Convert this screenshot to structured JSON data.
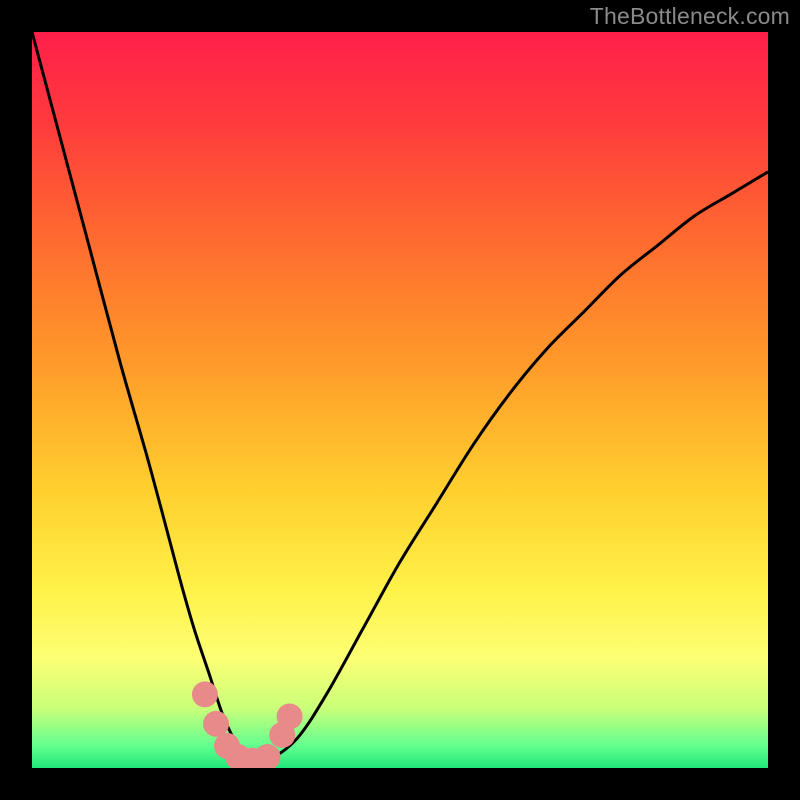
{
  "watermark": "TheBottleneck.com",
  "colors": {
    "black": "#000000",
    "curve": "#000000",
    "marker": "#e88a8a",
    "gradient_stops": [
      {
        "offset": 0.0,
        "color": "#ff1f4a"
      },
      {
        "offset": 0.12,
        "color": "#ff3a3d"
      },
      {
        "offset": 0.28,
        "color": "#ff6a2f"
      },
      {
        "offset": 0.45,
        "color": "#ff9a2a"
      },
      {
        "offset": 0.62,
        "color": "#ffcf2e"
      },
      {
        "offset": 0.76,
        "color": "#fff24a"
      },
      {
        "offset": 0.85,
        "color": "#fdff74"
      },
      {
        "offset": 0.92,
        "color": "#c8ff7a"
      },
      {
        "offset": 0.97,
        "color": "#62ff8f"
      },
      {
        "offset": 1.0,
        "color": "#20e87a"
      }
    ]
  },
  "chart_data": {
    "type": "line",
    "title": "",
    "xlabel": "",
    "ylabel": "",
    "xlim": [
      0,
      100
    ],
    "ylim": [
      0,
      100
    ],
    "series": [
      {
        "name": "bottleneck-curve",
        "x": [
          0,
          4,
          8,
          12,
          16,
          20,
          22,
          24,
          26,
          28,
          30,
          32,
          36,
          40,
          45,
          50,
          55,
          60,
          65,
          70,
          75,
          80,
          85,
          90,
          95,
          100
        ],
        "values": [
          100,
          85,
          70,
          55,
          41,
          26,
          19,
          13,
          7,
          3,
          1,
          1,
          4,
          10,
          19,
          28,
          36,
          44,
          51,
          57,
          62,
          67,
          71,
          75,
          78,
          81
        ]
      }
    ],
    "markers": [
      {
        "x": 23.5,
        "y": 10
      },
      {
        "x": 25.0,
        "y": 6
      },
      {
        "x": 26.5,
        "y": 3
      },
      {
        "x": 28.0,
        "y": 1.5
      },
      {
        "x": 30.0,
        "y": 1
      },
      {
        "x": 32.0,
        "y": 1.5
      },
      {
        "x": 34.0,
        "y": 4.5
      },
      {
        "x": 35.0,
        "y": 7
      }
    ]
  }
}
